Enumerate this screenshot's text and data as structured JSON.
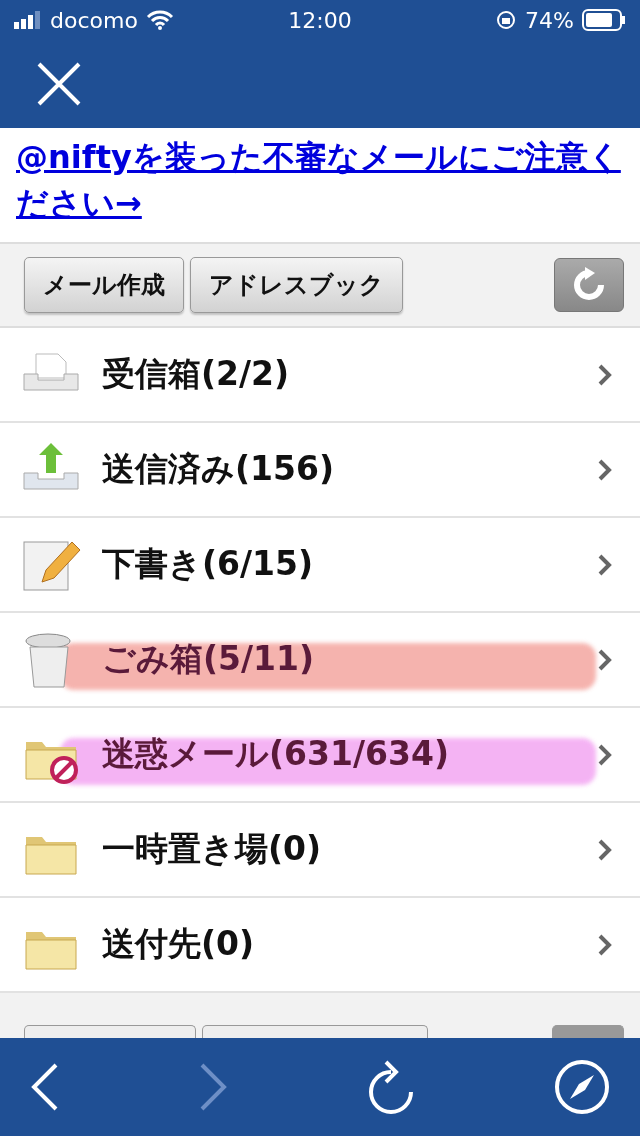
{
  "status_bar": {
    "carrier": "docomo",
    "time": "12:00",
    "battery": "74%"
  },
  "notice_link": "@niftyを装った不審なメールにご注意ください→",
  "toolbar": {
    "buttons": [
      "メール作成",
      "アドレスブック"
    ]
  },
  "folders": [
    {
      "kind": "inbox",
      "label": "受信箱(2/2)"
    },
    {
      "kind": "sent",
      "label": "送信済み(156)"
    },
    {
      "kind": "drafts",
      "label": "下書き(6/15)"
    },
    {
      "kind": "trash",
      "label": "ごみ箱(5/11)",
      "color": "#f4a6a0"
    },
    {
      "kind": "spam",
      "label": "迷惑メール(631/634)",
      "color": "#f3a6f2"
    },
    {
      "kind": "folder",
      "label": "一時置き場(0)"
    },
    {
      "kind": "folder",
      "label": "送付先(0)"
    }
  ],
  "browser_bar": [
    {
      "kind": "back",
      "disabled": false
    },
    {
      "kind": "forward",
      "disabled": true
    },
    {
      "kind": "reload",
      "disabled": false
    },
    {
      "kind": "compass",
      "disabled": false
    }
  ]
}
